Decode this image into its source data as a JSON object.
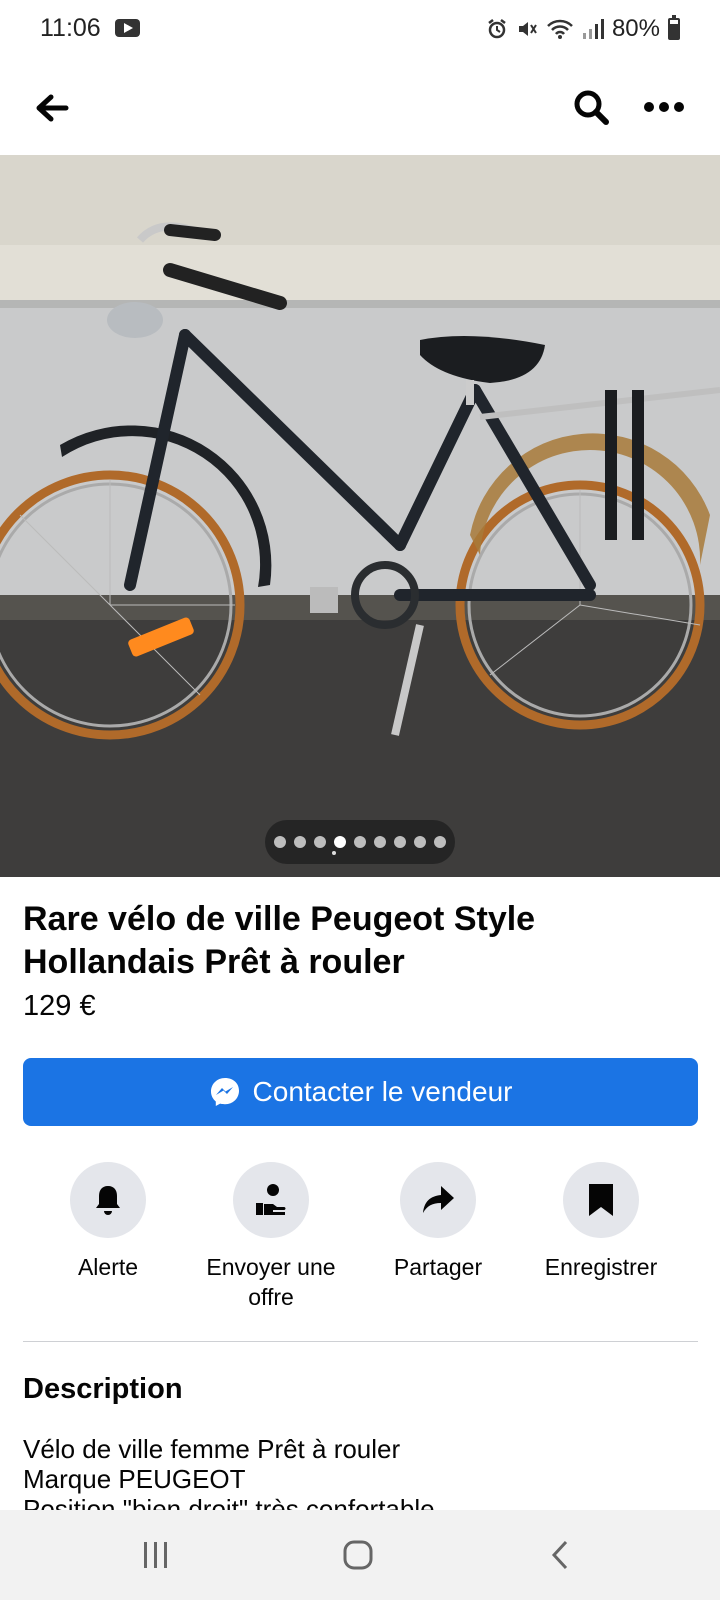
{
  "status_bar": {
    "time": "11:06",
    "battery": "80%",
    "battery_level": 0.8
  },
  "listing": {
    "title": "Rare vélo de ville Peugeot Style Hollandais Prêt à rouler",
    "price": "129 €",
    "photo_count": 9,
    "active_photo_index": 3
  },
  "contact_button": {
    "label": "Contacter le vendeur",
    "color": "#1b74e4"
  },
  "actions": [
    {
      "label": "Alerte",
      "icon": "bell-icon"
    },
    {
      "label": "Envoyer une offre",
      "icon": "hand-offer-icon"
    },
    {
      "label": "Partager",
      "icon": "share-arrow-icon"
    },
    {
      "label": "Enregistrer",
      "icon": "bookmark-icon"
    }
  ],
  "description": {
    "heading": "Description",
    "text": "Vélo de ville femme Prêt à rouler\nMarque PEUGEOT\nPosition \"bien droit\" très confortable"
  }
}
